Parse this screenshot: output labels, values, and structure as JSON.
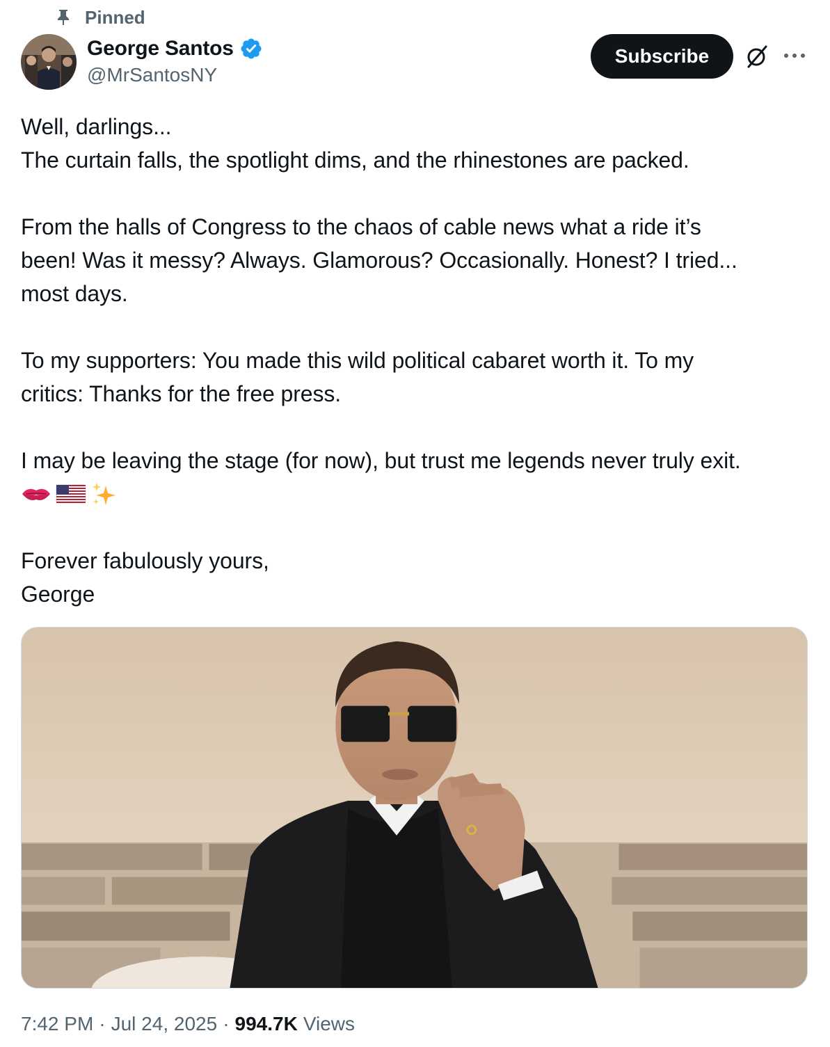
{
  "pinned": {
    "label": "Pinned"
  },
  "author": {
    "display_name": "George Santos",
    "handle": "@MrSantosNY",
    "verified": true,
    "verified_color": "#1d9bf0"
  },
  "actions": {
    "subscribe_label": "Subscribe",
    "grok_icon": "grok-slash-circle-icon",
    "more_icon": "more-dots-icon"
  },
  "tweet": {
    "lines": [
      "Well, darlings...",
      "The curtain falls, the spotlight dims, and the rhinestones are packed.",
      "",
      "From the halls of Congress to the chaos of cable news what a ride it’s",
      "been! Was it messy? Always. Glamorous? Occasionally. Honest? I tried...",
      "most days.",
      "",
      "To my supporters: You made this wild political cabaret worth it. To my",
      "critics: Thanks for the free press.",
      "",
      "I may be leaving the stage (for now), but trust me legends never truly exit.",
      "",
      "",
      "Forever fabulously yours,",
      "George"
    ],
    "emojis": [
      "kiss-mark-emoji",
      "us-flag-emoji",
      "sparkles-emoji"
    ]
  },
  "media": {
    "alt": ""
  },
  "meta": {
    "time": "7:42 PM",
    "date": "Jul 24, 2025",
    "separator": "·",
    "views_count": "994.7K",
    "views_label": "Views"
  },
  "colors": {
    "text_primary": "#0f1419",
    "text_secondary": "#536471",
    "border": "#cfd9de",
    "button_bg": "#0f1419"
  }
}
